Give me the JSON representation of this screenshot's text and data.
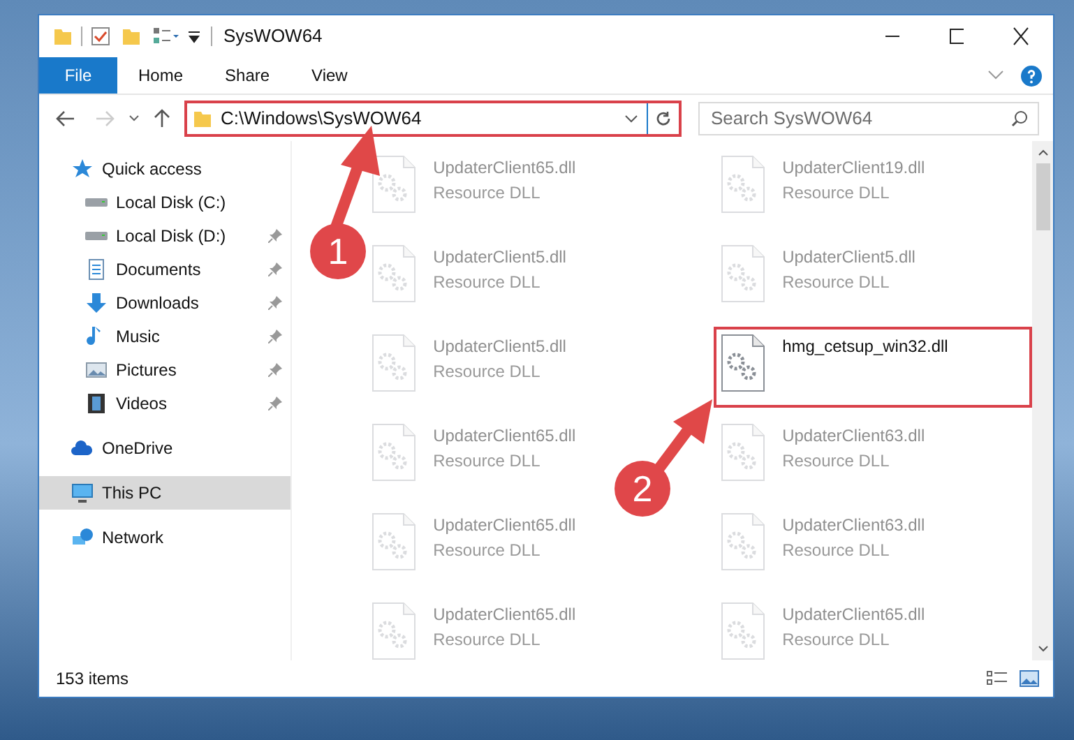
{
  "window": {
    "title": "SysWOW64"
  },
  "ribbon": {
    "file_label": "File",
    "tabs": [
      {
        "label": "Home",
        "selected": false
      },
      {
        "label": "Share",
        "selected": false
      },
      {
        "label": "View",
        "selected": false
      }
    ]
  },
  "address_bar": {
    "path": "C:\\Windows\\SysWOW64",
    "highlighted": true
  },
  "search": {
    "placeholder": "Search SysWOW64"
  },
  "sidebar": {
    "items": [
      {
        "label": "Quick access",
        "kind": "star",
        "selected": false,
        "children": [
          {
            "label": "Local Disk (C:)",
            "kind": "drive",
            "pinned": false,
            "selected": false
          },
          {
            "label": "Local Disk (D:)",
            "kind": "drive",
            "pinned": true,
            "selected": false
          },
          {
            "label": "Documents",
            "kind": "documents",
            "pinned": true,
            "selected": false
          },
          {
            "label": "Downloads",
            "kind": "downloads",
            "pinned": true,
            "selected": false
          },
          {
            "label": "Music",
            "kind": "music",
            "pinned": true,
            "selected": false
          },
          {
            "label": "Pictures",
            "kind": "pictures",
            "pinned": true,
            "selected": false
          },
          {
            "label": "Videos",
            "kind": "videos",
            "pinned": true,
            "selected": false
          }
        ]
      },
      {
        "label": "OneDrive",
        "kind": "cloud",
        "selected": false
      },
      {
        "label": "This PC",
        "kind": "pc",
        "selected": true
      },
      {
        "label": "Network",
        "kind": "network",
        "selected": false
      }
    ]
  },
  "files": [
    {
      "name": "UpdaterClient65.dll",
      "type": "Resource DLL",
      "highlighted": false
    },
    {
      "name": "UpdaterClient19.dll",
      "type": "Resource DLL",
      "highlighted": false
    },
    {
      "name": "UpdaterClient5.dll",
      "type": "Resource DLL",
      "highlighted": false
    },
    {
      "name": "UpdaterClient5.dll",
      "type": "Resource DLL",
      "highlighted": false
    },
    {
      "name": "UpdaterClient5.dll",
      "type": "Resource DLL",
      "highlighted": false
    },
    {
      "name": "hmg_cetsup_win32.dll",
      "highlighted": true
    },
    {
      "name": "UpdaterClient65.dll",
      "type": "Resource DLL",
      "highlighted": false
    },
    {
      "name": "UpdaterClient63.dll",
      "type": "Resource DLL",
      "highlighted": false
    },
    {
      "name": "UpdaterClient65.dll",
      "type": "Resource DLL",
      "highlighted": false
    },
    {
      "name": "UpdaterClient63.dll",
      "type": "Resource DLL",
      "highlighted": false
    },
    {
      "name": "UpdaterClient65.dll",
      "type": "Resource DLL",
      "highlighted": false
    },
    {
      "name": "UpdaterClient65.dll",
      "type": "Resource DLL",
      "highlighted": false
    }
  ],
  "status_bar": {
    "item_count": "153 items"
  },
  "annotations": [
    {
      "number": "1"
    },
    {
      "number": "2"
    }
  ]
}
